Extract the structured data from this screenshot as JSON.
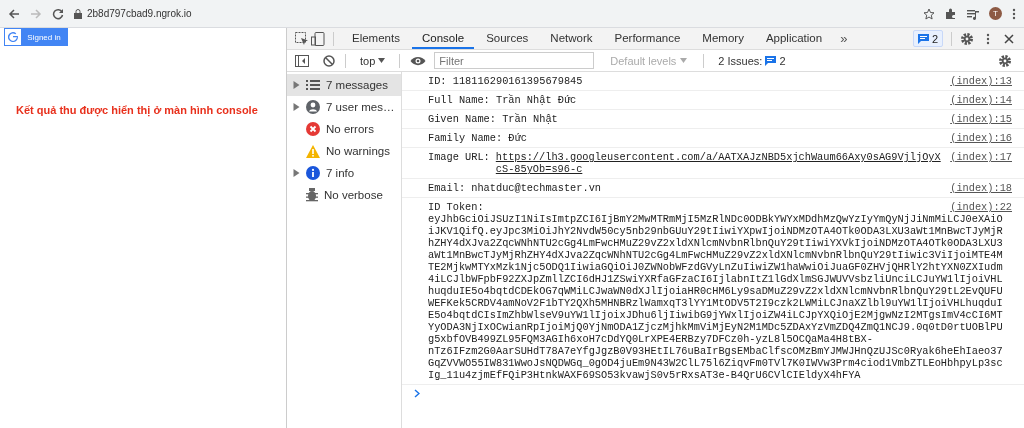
{
  "browser": {
    "url": "2b8d797cbad9.ngrok.io",
    "back_disabled": false,
    "forward_disabled": true,
    "avatar": "T"
  },
  "page": {
    "signin_button": "Signed in",
    "caption": "Kết quả thu được hiển thị ở màn hình console"
  },
  "devtools": {
    "tabs": [
      {
        "label": "Elements",
        "selected": false
      },
      {
        "label": "Console",
        "selected": true
      },
      {
        "label": "Sources",
        "selected": false
      },
      {
        "label": "Network",
        "selected": false
      },
      {
        "label": "Performance",
        "selected": false
      },
      {
        "label": "Memory",
        "selected": false
      },
      {
        "label": "Application",
        "selected": false
      }
    ],
    "more_tabs": "»",
    "message_badge": "2",
    "toolbar": {
      "context": "top",
      "filter_placeholder": "Filter",
      "levels": "Default levels",
      "issues_label": "2 Issues:",
      "issues_count": "2"
    },
    "sidebar": [
      {
        "label": "7 messages",
        "kind": "list",
        "expandable": true,
        "selected": true
      },
      {
        "label": "7 user mes…",
        "kind": "user",
        "expandable": true,
        "selected": false
      },
      {
        "label": "No errors",
        "kind": "error",
        "expandable": false,
        "selected": false
      },
      {
        "label": "No warnings",
        "kind": "warning",
        "expandable": false,
        "selected": false
      },
      {
        "label": "7 info",
        "kind": "info",
        "expandable": true,
        "selected": false
      },
      {
        "label": "No verbose",
        "kind": "verbose",
        "expandable": false,
        "selected": false
      }
    ],
    "messages": [
      {
        "kind": "plain",
        "text": "ID: 118116290161395679845",
        "source": "(index):13"
      },
      {
        "kind": "plain",
        "text": "Full Name: Trần Nhật Đức",
        "source": "(index):14"
      },
      {
        "kind": "plain",
        "text": "Given Name: Trần Nhật",
        "source": "(index):15"
      },
      {
        "kind": "plain",
        "text": "Family Name: Đức",
        "source": "(index):16"
      },
      {
        "kind": "link",
        "text": "Image URL:",
        "link": "https://lh3.googleusercontent.com/a/AATXAJzNBD5xjchWaum66Axy0sAG9VjljOyXcS-85yOb=s96-c",
        "source": "(index):17"
      },
      {
        "kind": "plain",
        "text": "Email: nhatduc@techmaster.vn",
        "source": "(index):18"
      },
      {
        "kind": "token",
        "text": "ID Token:",
        "source": "(index):22",
        "lines": [
          "eyJhbGciOiJSUzI1NiIsImtpZCI6IjBmY2MwMTRmMjI5MzRlNDc0ODBkYWYxMDdhMzQwYzIyYmQyNjJiNmMiLCJ0eXAiO",
          "iJKV1QifQ.eyJpc3MiOiJhY2NvdW50cy5nb29nbGUuY29tIiwiYXpwIjoiNDMzOTA4OTk0ODA3LXU3aWt1MnBwcTJyMjR",
          "hZHY4dXJva2ZqcWNhNTU2cGg4LmFwcHMuZ29vZ2xldXNlcmNvbnRlbnQuY29tIiwiYXVkIjoiNDMzOTA4OTk0ODA3LXU3",
          "aWt1MnBwcTJyMjRhZHY4dXJva2ZqcWNhNTU2cGg4LmFwcHMuZ29vZ2xldXNlcmNvbnRlbnQuY29tIiwic3ViIjoiMTE4M",
          "TE2MjkwMTYxMzk1Njc5ODQ1IiwiaGQiOiJ0ZWNobWFzdGVyLnZuIiwiZW1haWwiOiJuaGF0ZHVjQHRlY2htYXN0ZXIudm",
          "4iLCJlbWFpbF92ZXJpZmllZCI6dHJ1ZSwiYXRfaGFzaCI6IjlabnItZ1lGdXlmSGJWUVVsbzliUnciLCJuYW1lIjoiVHL",
          "huqduIE5o4bqtdCDEkOG7qWMiLCJwaWN0dXJlIjoiaHR0cHM6Ly9saDMuZ29vZ2xldXNlcmNvbnRlbnQuY29tL2EvQUFU",
          "WEFKek5CRDV4amNoV2F1bTY2QXh5MHNBRzlWamxqT3lYY1MtODV5T2I9czk2LWMiLCJnaXZlbl9uYW1lIjoiVHLhuqduI",
          "E5o4bqtdCIsImZhbWlseV9uYW1lIjoixJDhu6ljIiwibG9jYWxlIjoiZW4iLCJpYXQiOjE2MjgwNzI2MTgsImV4cCI6MT",
          "YyODA3NjIxOCwianRpIjoiMjQ0YjNmODA1ZjczMjhkMmViMjEyN2M1MDc5ZDAxYzVmZDQ4ZmQ1NCJ9.0q0tD0rtUOBlPU",
          "g5xbfOVB499ZL95FQM3AGIh6xoH7cDdYQ0LrXPE4ERBzy7DFCz0h-yzL8l5OCQaMa4H8tBX-",
          "nTz6IFzm2G0AarSUHdT78A7eYfgJgzB0V93HEtIL76uBaIrBgsEMbaClfscOMzBmYJMWJHnQzUJSc0Ryak6heEhIaeo37",
          "GqZVVWO55IW831WwoJsNQDWGq_0gOD4juEm9N43W2ClL75l6ZiqvFm0TVl7K0IWVw3Prm4ciod1VmbZTLEoHbhpyLp3sc",
          "Ig_11u4zjmEfFQiP3HtnkWAXF69SO53kvawjS0v5rRxsAT3e-B4QrU6CVlCIEldyX4hFYA"
        ]
      }
    ]
  }
}
